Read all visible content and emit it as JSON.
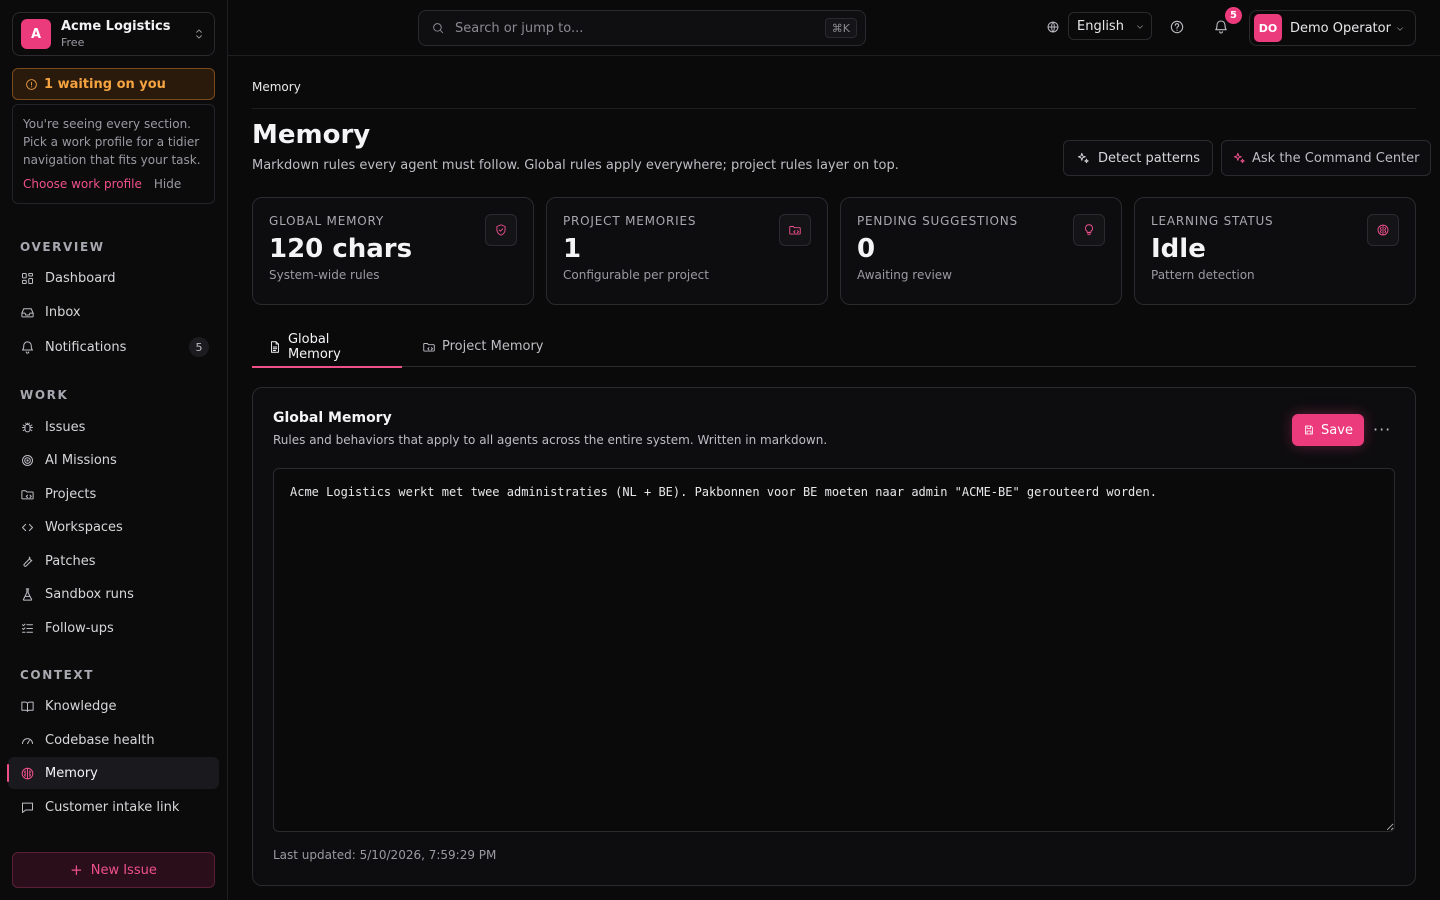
{
  "org": {
    "initial": "A",
    "name": "Acme Logistics",
    "plan": "Free"
  },
  "waiting": {
    "label": "1 waiting on you"
  },
  "profile_card": {
    "text": "You're seeing every section. Pick a work profile for a tidier navigation that fits your task.",
    "choose_label": "Choose work profile",
    "hide_label": "Hide"
  },
  "sidebar": {
    "overview_title": "OVERVIEW",
    "overview": [
      {
        "label": "Dashboard",
        "icon": "grid-icon"
      },
      {
        "label": "Inbox",
        "icon": "inbox-icon"
      },
      {
        "label": "Notifications",
        "icon": "bell-icon",
        "count": "5"
      }
    ],
    "work_title": "WORK",
    "work": [
      {
        "label": "Issues",
        "icon": "bug-icon"
      },
      {
        "label": "AI Missions",
        "icon": "target-icon"
      },
      {
        "label": "Projects",
        "icon": "folder-icon"
      },
      {
        "label": "Workspaces",
        "icon": "code-icon"
      },
      {
        "label": "Patches",
        "icon": "wrench-icon"
      },
      {
        "label": "Sandbox runs",
        "icon": "flask-icon"
      },
      {
        "label": "Follow-ups",
        "icon": "list-check-icon"
      }
    ],
    "context_title": "CONTEXT",
    "context": [
      {
        "label": "Knowledge",
        "icon": "book-icon"
      },
      {
        "label": "Codebase health",
        "icon": "gauge-icon"
      },
      {
        "label": "Memory",
        "icon": "brain-icon",
        "active": true
      },
      {
        "label": "Customer intake link",
        "icon": "message-icon"
      }
    ],
    "new_issue_label": "New Issue"
  },
  "topbar": {
    "search_placeholder": "Search or jump to...",
    "shortcut": "⌘K",
    "language": "English",
    "notification_count": "5",
    "user_initials": "DO",
    "user_name": "Demo Operator"
  },
  "page": {
    "breadcrumb": "Memory",
    "title": "Memory",
    "subtitle": "Markdown rules every agent must follow. Global rules apply everywhere; project rules layer on top.",
    "detect_label": "Detect patterns",
    "ask_label": "Ask the Command Center"
  },
  "stats": [
    {
      "label": "GLOBAL MEMORY",
      "value": "120 chars",
      "desc": "System-wide rules",
      "icon": "shield-icon"
    },
    {
      "label": "PROJECT MEMORIES",
      "value": "1",
      "desc": "Configurable per project",
      "icon": "folder-code-icon"
    },
    {
      "label": "PENDING SUGGESTIONS",
      "value": "0",
      "desc": "Awaiting review",
      "icon": "lightbulb-icon"
    },
    {
      "label": "LEARNING STATUS",
      "value": "Idle",
      "desc": "Pattern detection",
      "icon": "brain-icon"
    }
  ],
  "tabs": [
    {
      "label": "Global Memory",
      "icon": "file-text-icon",
      "active": true
    },
    {
      "label": "Project Memory",
      "icon": "folder-code-icon",
      "active": false
    }
  ],
  "card": {
    "title": "Global Memory",
    "subtitle": "Rules and behaviors that apply to all agents across the entire system. Written in markdown.",
    "save_label": "Save",
    "more_label": "···",
    "editor_value": "Acme Logistics werkt met twee administraties (NL + BE). Pakbonnen voor BE moeten naar admin \"ACME-BE\" gerouteerd worden.",
    "last_updated": "Last updated: 5/10/2026, 7:59:29 PM"
  },
  "colors": {
    "accent": "#ec3b7c",
    "warning": "#f4a340",
    "background": "#0a0a0b"
  }
}
